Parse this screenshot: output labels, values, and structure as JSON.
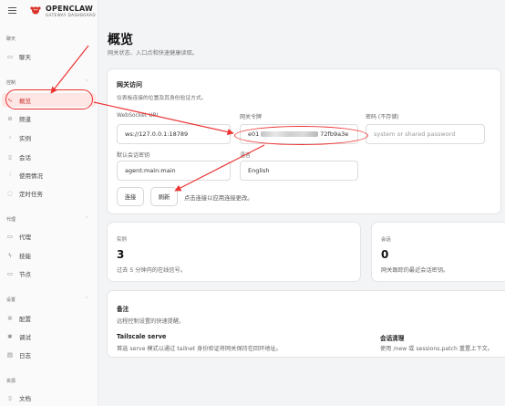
{
  "brand": {
    "name": "OPENCLAW",
    "subtitle": "GATEWAY DASHBOARD"
  },
  "sidebar": {
    "chat_section": "聊天",
    "chat_item": "聊天",
    "control_section": "控制",
    "control_items": [
      {
        "label": "概览",
        "icon": "activity-icon",
        "active": true
      },
      {
        "label": "频道",
        "icon": "link-icon"
      },
      {
        "label": "实例",
        "icon": "radio-icon"
      },
      {
        "label": "会话",
        "icon": "document-icon"
      },
      {
        "label": "使用情况",
        "icon": "bar-chart-icon"
      },
      {
        "label": "定时任务",
        "icon": "clock-icon"
      }
    ],
    "agent_section": "代理",
    "agent_items": [
      {
        "label": "代理",
        "icon": "folder-icon"
      },
      {
        "label": "技能",
        "icon": "zap-icon"
      },
      {
        "label": "节点",
        "icon": "monitor-icon"
      }
    ],
    "settings_section": "设置",
    "settings_items": [
      {
        "label": "配置",
        "icon": "gear-icon"
      },
      {
        "label": "调试",
        "icon": "bug-icon"
      },
      {
        "label": "日志",
        "icon": "log-icon"
      }
    ],
    "resources_section": "资源",
    "resources_items": [
      {
        "label": "文档",
        "icon": "book-icon"
      }
    ]
  },
  "page": {
    "title": "概览",
    "subtitle": "网关状态、入口点和快速健康读取。"
  },
  "gateway": {
    "title": "网关访问",
    "subtitle": "仪表板连接的位置及其身份验证方式。",
    "ws_label": "WebSocket URL",
    "ws_value": "ws://127.0.0.1:18789",
    "token_label": "网关令牌",
    "token_prefix": "e01",
    "token_suffix": "72fb9a3e",
    "password_label": "密码 (不存储)",
    "password_placeholder": "system or shared password",
    "session_label": "默认会话密钥",
    "session_value": "agent:main:main",
    "lang_label": "语言",
    "lang_value": "English",
    "connect_btn": "连接",
    "refresh_btn": "刷新",
    "hint": "点击连接以应用连接更改。"
  },
  "stats": {
    "instances_label": "实例",
    "instances_value": "3",
    "instances_desc": "过去 5 分钟内的在线信号。",
    "sessions_label": "会话",
    "sessions_value": "0",
    "sessions_desc": "网关跟踪的最近会话密钥。"
  },
  "notes": {
    "title": "备注",
    "subtitle": "远程控制设置的快速提醒。",
    "tailscale_title": "Tailscale serve",
    "tailscale_text": "首选 serve 模式以通过 tailnet 身份验证将网关保持在回环地址。",
    "session_title": "会话清理",
    "session_text": "使用 /new 或 sessions.patch 重置上下文。"
  },
  "colors": {
    "accent": "#e33",
    "active_bg": "#fde6e3"
  }
}
